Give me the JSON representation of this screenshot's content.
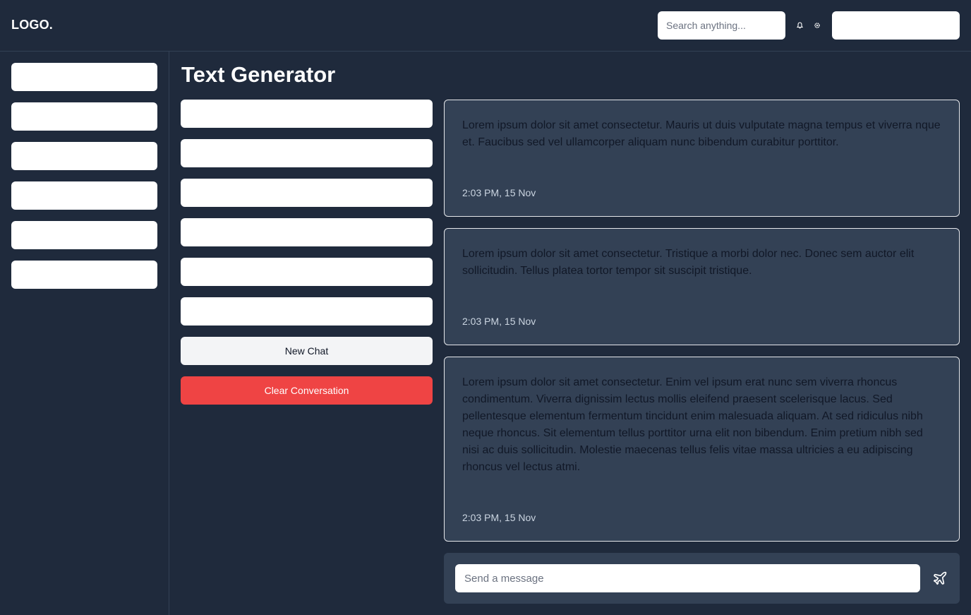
{
  "header": {
    "logo": "LOGO.",
    "search_placeholder": "Search anything...",
    "icons": [
      "bell-icon",
      "gear-icon"
    ]
  },
  "sidebar": {
    "items": [
      "",
      "",
      "",
      "",
      "",
      ""
    ]
  },
  "main": {
    "title": "Text Generator",
    "options": [
      "",
      "",
      "",
      "",
      "",
      ""
    ],
    "new_chat_label": "New Chat",
    "clear_label": "Clear Conversation"
  },
  "messages": [
    {
      "text": "Lorem ipsum dolor sit amet consectetur. Mauris ut duis vulputate magna tempus et viverra nque et. Faucibus sed vel ullamcorper aliquam nunc bibendum curabitur porttitor.",
      "time": "2:03 PM, 15 Nov"
    },
    {
      "text": "Lorem ipsum dolor sit amet consectetur. Tristique a morbi dolor nec. Donec sem auctor elit sollicitudin. Tellus platea tortor tempor sit suscipit tristique.",
      "time": "2:03 PM, 15 Nov"
    },
    {
      "text": "Lorem ipsum dolor sit amet consectetur. Enim vel ipsum erat nunc sem viverra rhoncus condimentum. Viverra dignissim lectus mollis eleifend praesent scelerisque lacus. Sed pellentesque elementum fermentum tincidunt enim malesuada aliquam. At sed ridiculus nibh neque rhoncus. Sit elementum tellus porttitor urna elit non bibendum. Enim pretium nibh sed nisi ac duis sollicitudin. Molestie maecenas tellus felis vitae massa ultricies a eu adipiscing rhoncus vel lectus atmi.",
      "time": "2:03 PM, 15 Nov"
    }
  ],
  "composer": {
    "placeholder": "Send a message",
    "send_icon": "send-plane-icon"
  },
  "colors": {
    "background": "#1f2a3c",
    "panel": "#334155",
    "danger": "#ef4444"
  }
}
